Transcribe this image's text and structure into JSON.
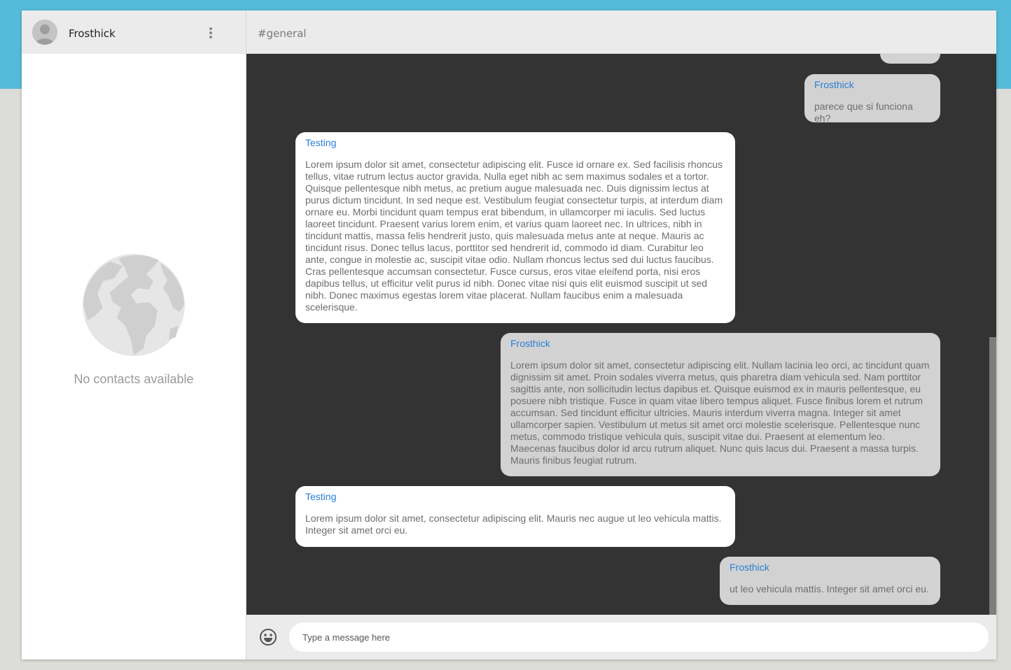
{
  "sidebar": {
    "username": "Frosthick",
    "empty_text": "No contacts available"
  },
  "channel": {
    "name": "#general"
  },
  "messages": [
    {
      "author": "Frosthick",
      "text": "parece que si funciona eh?",
      "mine": true
    },
    {
      "author": "Testing",
      "text": "Lorem ipsum dolor sit amet, consectetur adipiscing elit. Fusce id ornare ex. Sed facilisis rhoncus tellus, vitae rutrum lectus auctor gravida. Nulla eget nibh ac sem maximus sodales et a tortor. Quisque pellentesque nibh metus, ac pretium augue malesuada nec. Duis dignissim lectus at purus dictum tincidunt. In sed neque est. Vestibulum feugiat consectetur turpis, at interdum diam ornare eu. Morbi tincidunt quam tempus erat bibendum, in ullamcorper mi iaculis. Sed luctus laoreet tincidunt. Praesent varius lorem enim, et varius quam laoreet nec. In ultrices, nibh in tincidunt mattis, massa felis hendrerit justo, quis malesuada metus ante at neque. Mauris ac tincidunt risus. Donec tellus lacus, porttitor sed hendrerit id, commodo id diam. Curabitur leo ante, congue in molestie ac, suscipit vitae odio. Nullam rhoncus lectus sed dui luctus faucibus. Cras pellentesque accumsan consectetur. Fusce cursus, eros vitae eleifend porta, nisi eros dapibus tellus, ut efficitur velit purus id nibh. Donec vitae nisi quis elit euismod suscipit ut sed nibh. Donec maximus egestas lorem vitae placerat. Nullam faucibus enim a malesuada scelerisque.",
      "mine": false
    },
    {
      "author": "Frosthick",
      "text": "Lorem ipsum dolor sit amet, consectetur adipiscing elit. Nullam lacinia leo orci, ac tincidunt quam dignissim sit amet. Proin sodales viverra metus, quis pharetra diam vehicula sed. Nam porttitor sagittis ante, non sollicitudin lectus dapibus et. Quisque euismod ex in mauris pellentesque, eu posuere nibh tristique. Fusce in quam vitae libero tempus aliquet. Fusce finibus lorem et rutrum accumsan. Sed tincidunt efficitur ultricies. Mauris interdum viverra magna. Integer sit amet ullamcorper sapien. Vestibulum ut metus sit amet orci molestie scelerisque. Pellentesque nunc metus, commodo tristique vehicula quis, suscipit vitae dui. Praesent at elementum leo. Maecenas faucibus dolor id arcu rutrum aliquet. Nunc quis lacus dui. Praesent a massa turpis. Mauris finibus feugiat rutrum.",
      "mine": true
    },
    {
      "author": "Testing",
      "text": "Lorem ipsum dolor sit amet, consectetur adipiscing elit. Mauris nec augue ut leo vehicula mattis. Integer sit amet orci eu.",
      "mine": false
    },
    {
      "author": "Frosthick",
      "text": "ut leo vehicula mattis. Integer sit amet orci eu.",
      "mine": true
    }
  ],
  "composer": {
    "placeholder": "Type a message here"
  },
  "icons": {
    "avatar": "user-avatar-icon",
    "menu": "more-vert-icon",
    "globe": "globe-icon",
    "emoji": "emoji-icon"
  },
  "colors": {
    "accent": "#2a7fd4",
    "background_band": "#56bad9",
    "chat_background": "#333333",
    "bubble_other": "#ffffff",
    "bubble_mine": "#d2d2d2"
  }
}
